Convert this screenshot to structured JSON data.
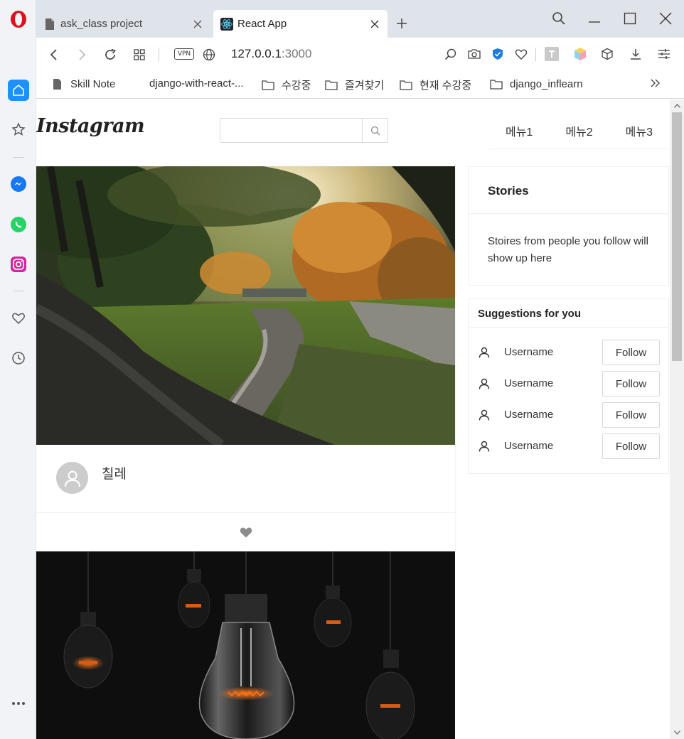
{
  "browser": {
    "tabs": [
      {
        "title": "ask_class project",
        "active": false
      },
      {
        "title": "React App",
        "active": true
      }
    ],
    "vpn_label": "VPN",
    "url_host": "127.0.0.1",
    "url_port": ":3000",
    "bookmarks": [
      {
        "label": "Skill Note",
        "icon": "document-icon"
      },
      {
        "label": "django-with-react-...",
        "icon": "none"
      },
      {
        "label": "수강중",
        "icon": "folder-icon"
      },
      {
        "label": "즐겨찾기",
        "icon": "folder-icon"
      },
      {
        "label": "현재 수강중",
        "icon": "folder-icon"
      },
      {
        "label": "django_inflearn",
        "icon": "folder-icon"
      }
    ],
    "accent_color": "#1e90ff"
  },
  "app": {
    "logo_text": "Instagram",
    "search_value": "",
    "menu": [
      "메뉴1",
      "메뉴2",
      "메뉴3"
    ],
    "posts": [
      {
        "image": "autumn-stream-photo",
        "caption": "칠레"
      },
      {
        "image": "light-bulbs-photo",
        "caption": ""
      }
    ],
    "stories": {
      "title": "Stories",
      "body": "Stoires from people you follow will show up here"
    },
    "suggestions": {
      "title": "Suggestions for you",
      "items": [
        {
          "username": "Username",
          "button": "Follow"
        },
        {
          "username": "Username",
          "button": "Follow"
        },
        {
          "username": "Username",
          "button": "Follow"
        },
        {
          "username": "Username",
          "button": "Follow"
        }
      ]
    }
  }
}
